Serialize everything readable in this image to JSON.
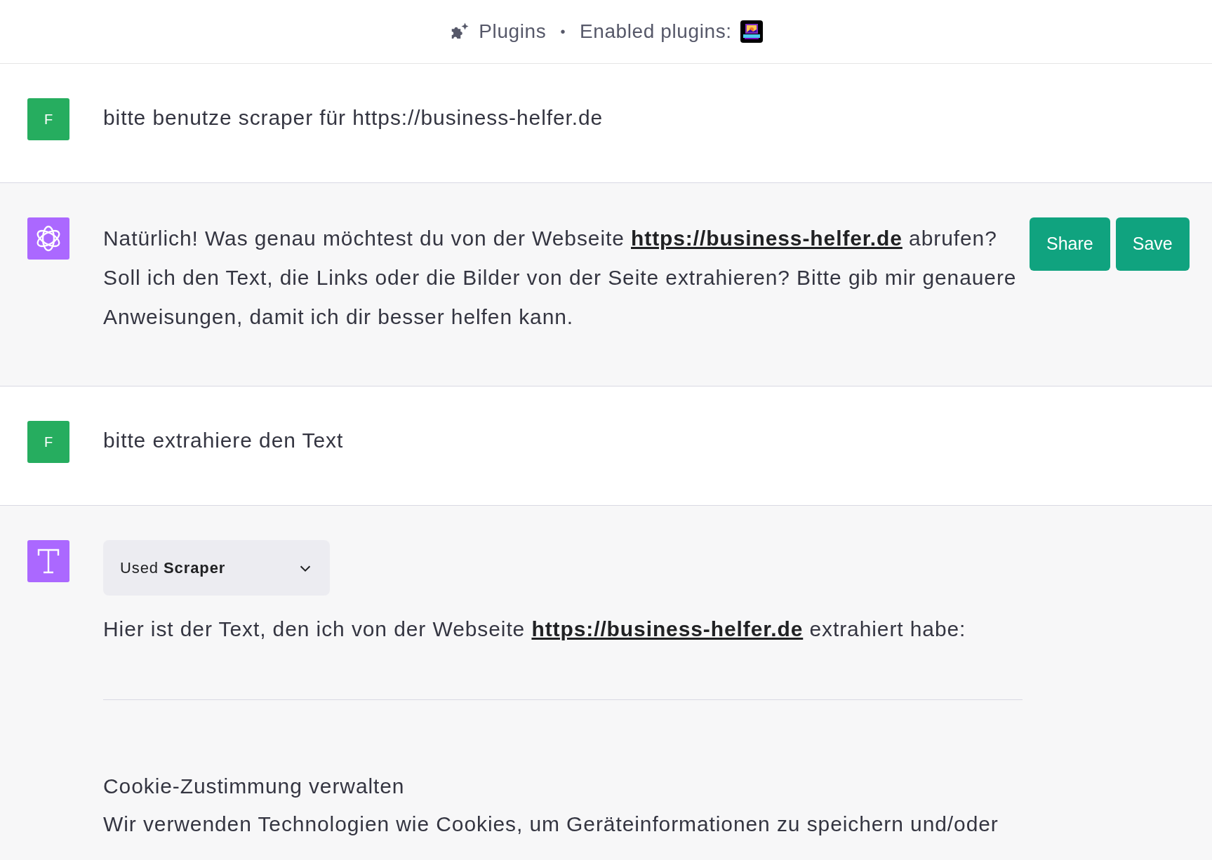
{
  "header": {
    "title": "Plugins",
    "separator": "•",
    "enabled_label": "Enabled plugins:"
  },
  "messages": [
    {
      "kind": "user",
      "avatar": "F",
      "parts": [
        {
          "kind": "text",
          "text": "bitte benutze scraper für https://business-helfer.de"
        }
      ]
    },
    {
      "kind": "assistant",
      "parts": [
        {
          "kind": "text",
          "text": "Natürlich! Was genau möchtest du von der Webseite "
        },
        {
          "kind": "link",
          "text": "https://business-helfer.de"
        },
        {
          "kind": "text",
          "text": " abrufen? Soll ich den Text, die Links oder die Bilder von der Seite extrahieren? Bitte gib mir genauere Anweisungen, damit ich dir besser helfen kann."
        }
      ],
      "actions": [
        "Share",
        "Save"
      ]
    },
    {
      "kind": "user",
      "avatar": "F",
      "parts": [
        {
          "kind": "text",
          "text": "bitte extrahiere den Text"
        }
      ]
    },
    {
      "kind": "plugin",
      "tool": {
        "prefix": "Used",
        "name": "Scraper",
        "expanded": false
      },
      "parts": [
        {
          "kind": "text",
          "text": "Hier ist der Text, den ich von der Webseite "
        },
        {
          "kind": "link",
          "text": "https://business-helfer.de"
        },
        {
          "kind": "text",
          "text": " extrahiert habe:"
        }
      ],
      "extract": {
        "heading": "Cookie-Zustimmung verwalten",
        "paragraph": "Wir verwenden Technologien wie Cookies, um Geräteinformationen zu speichern und/oder"
      }
    }
  ]
}
